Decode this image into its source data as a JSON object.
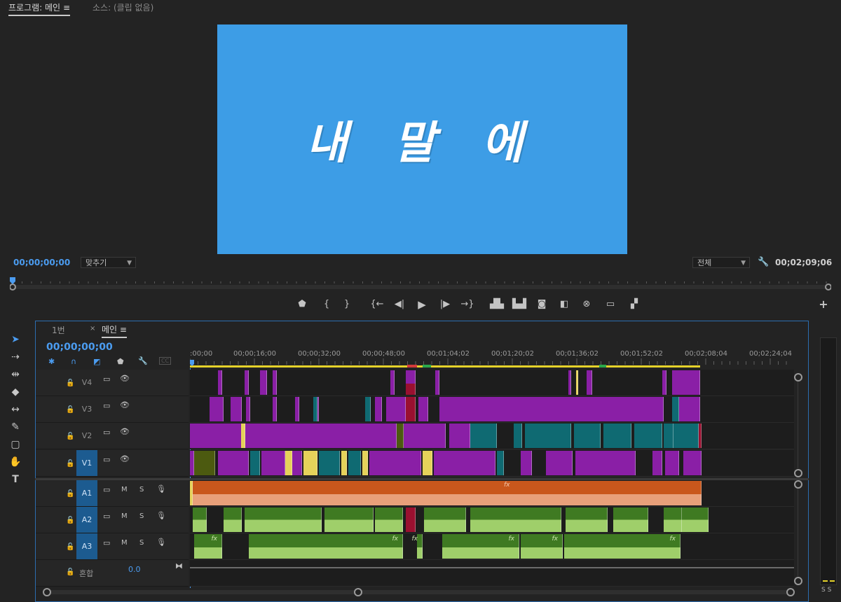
{
  "monitor": {
    "tab_program": "프로그램: 메인",
    "tab_source": "소스: (클립 없음)",
    "overlay_text": "내 말 에",
    "timecode_current": "00;00;00;00",
    "fit_label": "맞추기",
    "quality_label": "전체",
    "timecode_duration": "00;02;09;06"
  },
  "timeline": {
    "tab_1": "1번",
    "tab_main": "메인",
    "timecode": "00;00;00;00",
    "ruler_ticks": [
      ":00;00",
      "00;00;16;00",
      "00;00;32;00",
      "00;00;48;00",
      "00;01;04;02",
      "00;01;20;02",
      "00;01;36;02",
      "00;01;52;02",
      "00;02;08;04",
      "00;02;24;04"
    ],
    "video_tracks": [
      "V4",
      "V3",
      "V2",
      "V1"
    ],
    "audio_tracks": [
      "A1",
      "A2",
      "A3"
    ],
    "mix_label": "혼합",
    "mix_value": "0.0",
    "m_label": "M",
    "s_label": "S",
    "fx_label": "fx",
    "meter_labels": "S S"
  },
  "colors": {
    "accent": "#4b9cf0",
    "video_frame": "#3d9de6",
    "clip_purple": "#8a1fa6",
    "clip_teal": "#0f6a72",
    "clip_yellow": "#e5d25a",
    "clip_olive": "#4c5a10",
    "clip_crimson": "#9a1030",
    "audio_orange": "#c9571c",
    "audio_green": "#3f7a22"
  }
}
